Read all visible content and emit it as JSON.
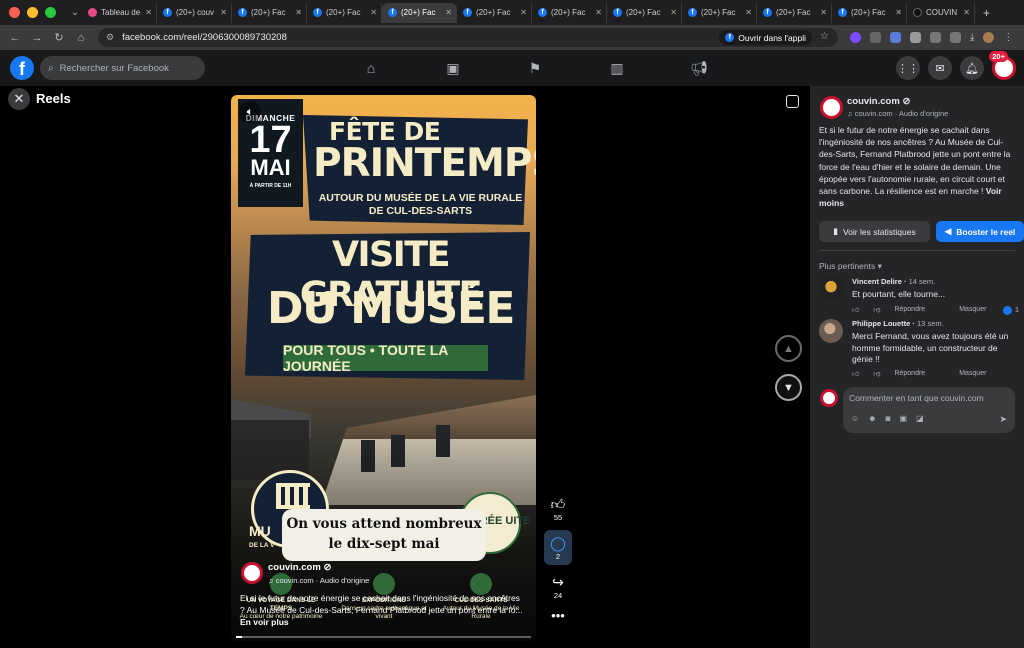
{
  "browser": {
    "tabs": [
      {
        "label": "Tableau de",
        "icon": "pink"
      },
      {
        "label": "(20+) couv",
        "icon": "fb"
      },
      {
        "label": "(20+) Fac",
        "icon": "fb"
      },
      {
        "label": "(20+) Fac",
        "icon": "fb"
      },
      {
        "label": "(20+) Fac",
        "icon": "fb",
        "active": true
      },
      {
        "label": "(20+) Fac",
        "icon": "fb"
      },
      {
        "label": "(20+) Fac",
        "icon": "fb"
      },
      {
        "label": "(20+) Fac",
        "icon": "fb"
      },
      {
        "label": "(20+) Fac",
        "icon": "fb"
      },
      {
        "label": "(20+) Fac",
        "icon": "fb"
      },
      {
        "label": "(20+) Fac",
        "icon": "fb"
      },
      {
        "label": "COUVIN",
        "icon": "tiktok"
      }
    ],
    "new_tab": "+",
    "url": "facebook.com/reel/2906300089730208",
    "open_in_app": "Ouvrir dans l'appli"
  },
  "fb_header": {
    "logo": "f",
    "search_placeholder": "Rechercher sur Facebook",
    "nav_icons": [
      "home-icon",
      "video-icon",
      "flag-icon",
      "chart-icon",
      "megaphone-icon"
    ],
    "notif_count": "20+"
  },
  "reels": {
    "title": "Reels",
    "close": "✕"
  },
  "poster": {
    "dow": "DIMANCHE",
    "day": "17",
    "month": "MAI",
    "from": "À PARTIR DE 11H",
    "fete_line1": "FÊTE DE",
    "fete_line2": "PRINTEMPS",
    "fete_line3": "AUTOUR DU MUSÉE DE LA VIE RURALE DE CUL-DES-SARTS",
    "visite_line1": "VISITE GRATUITE",
    "visite_line2": "DU MUSÉE",
    "pour_tous": "POUR TOUS • TOUTE LA JOURNÉE",
    "musee": "MU",
    "musee_sub": "DE LA V",
    "entree": "TRÉE UITE",
    "caption": "On vous attend nombreux le dix-sept mai",
    "info": [
      {
        "title": "UN VOYAGE DANS LE TEMPS",
        "sub": "Au cœur de notre patrimoine"
      },
      {
        "title": "EXPOSITIONS",
        "sub": "Dans un cadre authentique et vivant"
      },
      {
        "title": "CUL-DES-SARTS",
        "sub": "Autour du Musée de la Vie Rurale"
      }
    ]
  },
  "video": {
    "author": "couvin.com",
    "audio": "couvin.com · Audio d'origine",
    "description": "Et si le futur de notre énergie se cachait dans l'ingéniosité de nos ancêtres ? Au Musée de Cul-des-Sarts, Fernand Platbrood jette un pont entre la fo...",
    "see_more": "En voir plus",
    "progress": 0.02,
    "likes": "55",
    "comments": "2",
    "shares": "24"
  },
  "side": {
    "author": "couvin.com",
    "audio": "couvin.com · Audio d'origine",
    "description": "Et si le futur de notre énergie se cachait dans l'ingéniosité de nos ancêtres ? Au Musée de Cul-des-Sarts, Fernand Platbrood jette un pont entre la force de l'eau d'hier et le solaire de demain. Une épopée vers l'autonomie rurale, en circuit court et sans carbone. La résilience est en marche !",
    "see_less": "Voir moins",
    "stats_btn": "Voir les statistiques",
    "boost_btn": "Booster le reel",
    "sort": "Plus pertinents",
    "comments": [
      {
        "name": "Vincent Delire",
        "time": "14 sem.",
        "text": "Et pourtant, elle tourne...",
        "reply": "Répondre",
        "hide": "Masquer",
        "likes": "1"
      },
      {
        "name": "Philippe Louette",
        "time": "13 sem.",
        "text": "Merci Fernand, vous avez toujours été un homme formidable, un constructeur de génie !!",
        "reply": "Répondre",
        "hide": "Masquer"
      }
    ],
    "composer_placeholder": "Commenter en tant que couvin.com"
  }
}
